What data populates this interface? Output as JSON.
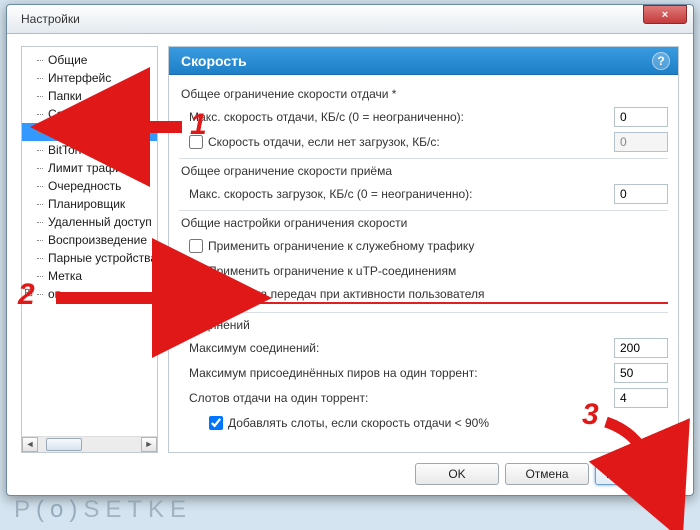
{
  "window": {
    "title": "Настройки",
    "close": "×"
  },
  "sidebar": {
    "items": [
      {
        "label": "Общие"
      },
      {
        "label": "Интерфейс"
      },
      {
        "label": "Папки"
      },
      {
        "label": "Соединение"
      },
      {
        "label": "Скорость",
        "selected": true
      },
      {
        "label": "BitTorrent"
      },
      {
        "label": "Лимит трафика"
      },
      {
        "label": "Очередность"
      },
      {
        "label": "Планировщик"
      },
      {
        "label": "Удаленный доступ"
      },
      {
        "label": "Воспроизведение"
      },
      {
        "label": "Парные устройства"
      },
      {
        "label": "Метка"
      },
      {
        "label": "оп",
        "plus": true
      }
    ]
  },
  "panel": {
    "title": "Скорость",
    "help": "?",
    "upload": {
      "section": "Общее ограничение скорости отдачи *",
      "max_label": "Макс. скорость отдачи, КБ/с (0 = неограниченно):",
      "max_value": "0",
      "alt_label": "Скорость отдачи, если нет загрузок, КБ/с:",
      "alt_value": "0",
      "alt_checked": false
    },
    "download": {
      "section": "Общее ограничение скорости приёма",
      "max_label": "Макс. скорость загрузок, КБ/с (0 = неограниченно):",
      "max_value": "0"
    },
    "limits": {
      "section": "Общие настройки ограничения скорости",
      "overhead_label": "Применить ограничение к служебному трафику",
      "overhead_checked": false,
      "utp_label": "Применить ограничение к uTP-соединениям",
      "utp_checked": true,
      "useractive_label": "Остановка передач при активности пользователя",
      "useractive_checked": true
    },
    "conns": {
      "section": "Соединений",
      "max_label": "Максимум соединений:",
      "max_value": "200",
      "peers_label": "Максимум присоединённых пиров на один торрент:",
      "peers_value": "50",
      "slots_label": "Слотов отдачи на один торрент:",
      "slots_value": "4",
      "extra_label": "Добавлять слоты, если скорость отдачи < 90%",
      "extra_checked": true
    }
  },
  "buttons": {
    "ok": "OK",
    "cancel": "Отмена",
    "apply": "Применить"
  },
  "annotations": {
    "n1": "1",
    "n2": "2",
    "n3": "3"
  },
  "watermark": "P(o)SETKE"
}
